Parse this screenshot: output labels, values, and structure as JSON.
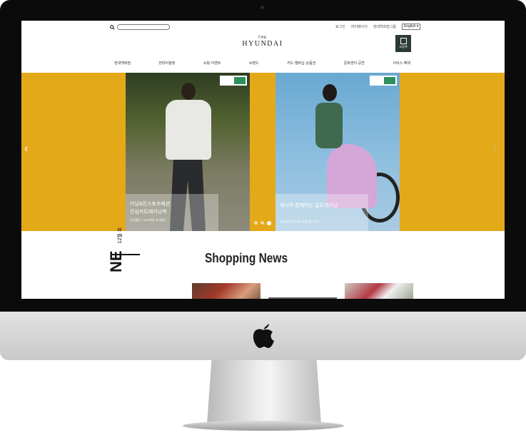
{
  "header": {
    "utility_links": [
      "로그인",
      "마이페이지",
      "현대백화점그룹"
    ],
    "language": "English",
    "logo_the": "THE",
    "logo_main": "HYUNDAI",
    "shopping_bag_label": "쇼핑백"
  },
  "nav": {
    "items": [
      "현대백화점",
      "현대아울렛",
      "쇼핑·이벤트",
      "브랜드",
      "카드·멤버십·상품권",
      "문화센터·공연",
      "서비스·혜택"
    ]
  },
  "banner": {
    "colors": {
      "background": "#e4a919",
      "tag_accent": "#2e8f5f"
    },
    "slides": [
      {
        "title_line1": "러닝&인스포츠패션",
        "title_line2": "안심카트레이닝복",
        "subtitle": "가격할인 + 20%쿠폰 추가할인"
      },
      {
        "title_line1": "제시와 함께하는 홈트레이닝",
        "title_line2": "",
        "subtitle": "헤드&바 단독 피트 상품 캠스기구"
      }
    ],
    "dots": {
      "total": 3,
      "active_index": 2
    },
    "prev_icon": "chevron-left-icon",
    "next_icon": "chevron-right-icon"
  },
  "section": {
    "title": "Shopping News",
    "vertical_text": "NE",
    "vertical_small": "12월 호"
  }
}
